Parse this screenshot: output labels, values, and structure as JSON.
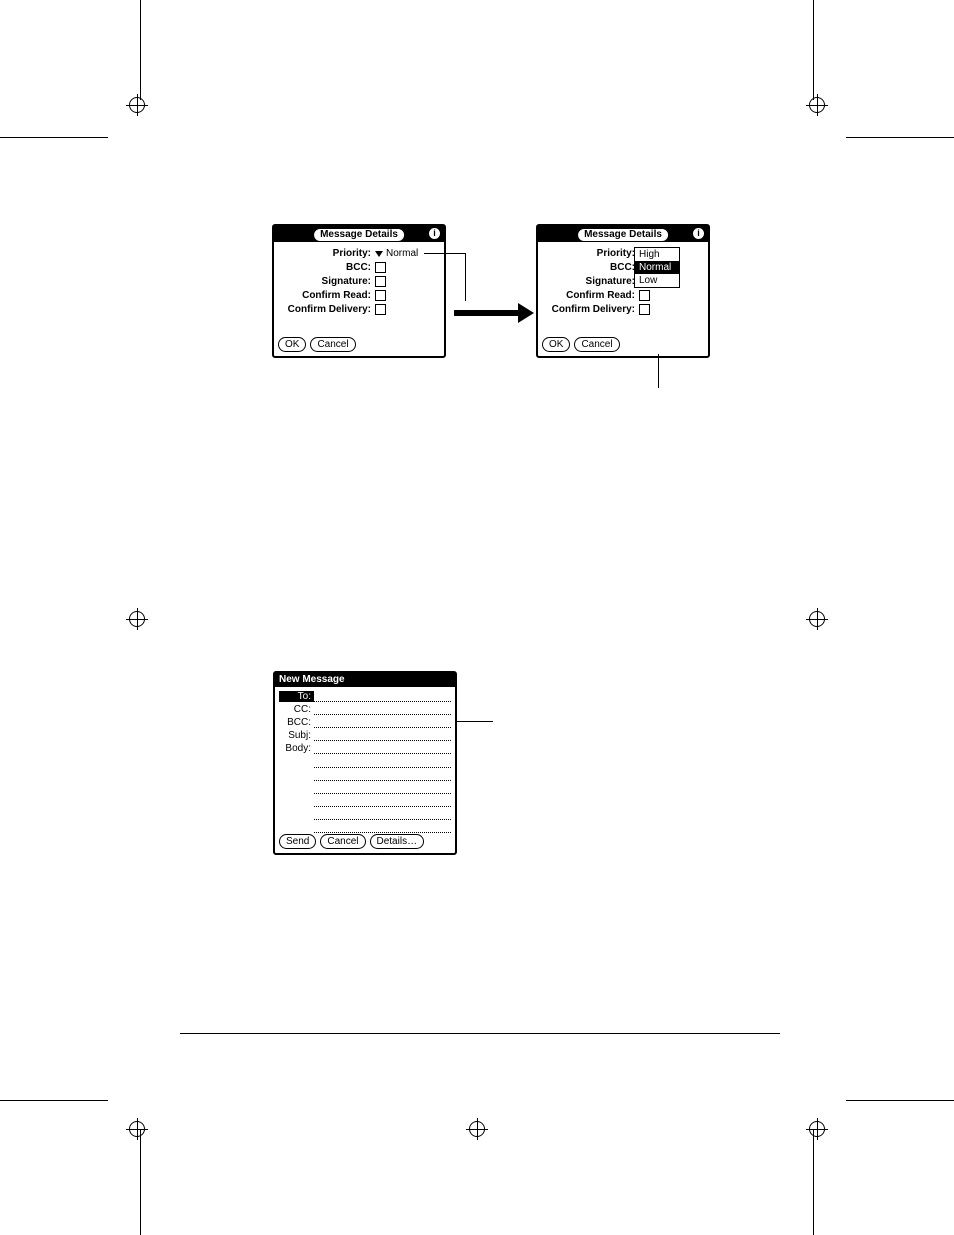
{
  "dialog1": {
    "title": "Message Details",
    "info_glyph": "i",
    "labels": {
      "priority": "Priority:",
      "bcc": "BCC:",
      "signature": "Signature:",
      "confirm_read": "Confirm Read:",
      "confirm_delivery": "Confirm Delivery:"
    },
    "priority_value": "Normal",
    "ok": "OK",
    "cancel": "Cancel"
  },
  "dialog2": {
    "title": "Message Details",
    "info_glyph": "i",
    "labels": {
      "priority": "Priority:",
      "bcc": "BCC:",
      "signature": "Signature:",
      "confirm_read": "Confirm Read:",
      "confirm_delivery": "Confirm Delivery:"
    },
    "priority_options": [
      "High",
      "Normal",
      "Low"
    ],
    "priority_selected": "Normal",
    "ok": "OK",
    "cancel": "Cancel"
  },
  "newmsg": {
    "title": "New Message",
    "labels": {
      "to": "To:",
      "cc": "CC:",
      "bcc": "BCC:",
      "subj": "Subj:",
      "body": "Body:"
    },
    "send": "Send",
    "cancel": "Cancel",
    "details": "Details…"
  }
}
